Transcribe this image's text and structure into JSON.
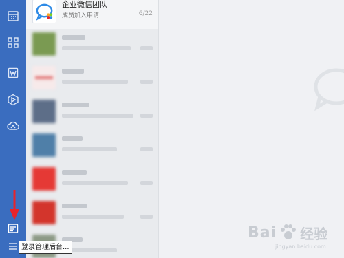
{
  "sidebar": {
    "icons": [
      "calendar-icon",
      "apps-grid-icon",
      "doc-icon",
      "drive-icon",
      "cloud-icon",
      "admin-console-icon",
      "menu-icon"
    ],
    "accent": "#3a6dbf"
  },
  "list": {
    "first": {
      "name": "企业微信团队",
      "sub": "成员加入申请",
      "count": "6/22"
    }
  },
  "tooltip": {
    "text": "登录管理后台..."
  },
  "watermark": {
    "brand": "Bai",
    "cn": "经验",
    "url": "jingyan.baidu.com"
  },
  "annotation": {
    "arrow_color": "#e8232b"
  }
}
